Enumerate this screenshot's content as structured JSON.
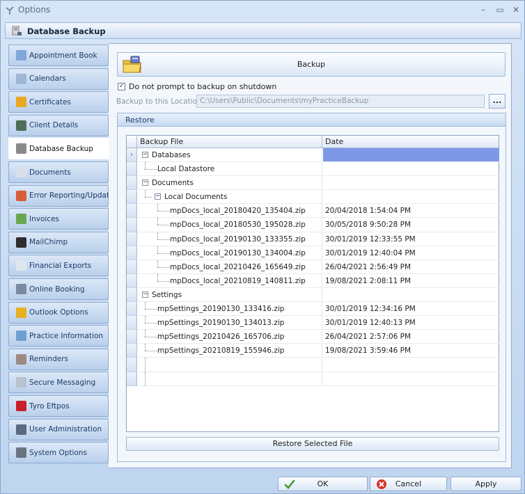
{
  "window": {
    "title": "Options",
    "controls": [
      "–",
      "▭",
      "✕"
    ]
  },
  "header": {
    "title": "Database Backup"
  },
  "sidebar": {
    "items": [
      {
        "label": "Appointment Book",
        "icon": "appointment-book-icon",
        "color": "#7fa7d8"
      },
      {
        "label": "Calendars",
        "icon": "calendar-icon",
        "color": "#9fb6d6"
      },
      {
        "label": "Certificates",
        "icon": "certificate-icon",
        "color": "#e8a820"
      },
      {
        "label": "Client Details",
        "icon": "client-details-icon",
        "color": "#4f6e58"
      },
      {
        "label": "Database Backup",
        "icon": "database-backup-icon",
        "color": "#8a8a8a",
        "active": true
      },
      {
        "label": "Documents",
        "icon": "documents-icon",
        "color": "#d9dfe8"
      },
      {
        "label": "Error Reporting/Updates",
        "icon": "error-reporting-icon",
        "color": "#d85c3a"
      },
      {
        "label": "Invoices",
        "icon": "invoices-icon",
        "color": "#6aa84f"
      },
      {
        "label": "MailChimp",
        "icon": "mailchimp-icon",
        "color": "#2e2e2e"
      },
      {
        "label": "Financial Exports",
        "icon": "financial-exports-icon",
        "color": "#dfe5ee"
      },
      {
        "label": "Online Booking",
        "icon": "online-booking-icon",
        "color": "#7a8aa0"
      },
      {
        "label": "Outlook Options",
        "icon": "outlook-icon",
        "color": "#e8b020"
      },
      {
        "label": "Practice Information",
        "icon": "practice-info-icon",
        "color": "#6f9fd0"
      },
      {
        "label": "Reminders",
        "icon": "reminders-icon",
        "color": "#9a8a80"
      },
      {
        "label": "Secure Messaging",
        "icon": "secure-messaging-icon",
        "color": "#b8c2d0"
      },
      {
        "label": "Tyro Eftpos",
        "icon": "tyro-eftpos-icon",
        "color": "#c8202a"
      },
      {
        "label": "User Administration",
        "icon": "user-admin-icon",
        "color": "#5a6a80"
      },
      {
        "label": "System Options",
        "icon": "system-options-icon",
        "color": "#6a7480"
      }
    ]
  },
  "backup": {
    "button_label": "Backup",
    "no_prompt_label": "Do not prompt to backup on shutdown",
    "no_prompt_checked": true,
    "location_label": "Backup to this Location:",
    "location_value": "C:\\Users\\Public\\Documents\\myPracticeBackup",
    "browse_label": "..."
  },
  "restore": {
    "title": "Restore",
    "columns": [
      "Backup File",
      "Date"
    ],
    "rows": [
      {
        "name": "Databases",
        "date": "",
        "level": 0,
        "expandable": true,
        "selected": true
      },
      {
        "name": "Local Datastore",
        "date": "",
        "level": 1,
        "expandable": false
      },
      {
        "name": "Documents",
        "date": "",
        "level": 0,
        "expandable": true
      },
      {
        "name": "Local Documents",
        "date": "",
        "level": 1,
        "expandable": true
      },
      {
        "name": "mpDocs_local_20180420_135404.zip",
        "date": "20/04/2018 1:54:04 PM",
        "level": 2,
        "expandable": false
      },
      {
        "name": "mpDocs_local_20180530_195028.zip",
        "date": "30/05/2018 9:50:28 PM",
        "level": 2,
        "expandable": false
      },
      {
        "name": "mpDocs_local_20190130_133355.zip",
        "date": "30/01/2019 12:33:55 PM",
        "level": 2,
        "expandable": false
      },
      {
        "name": "mpDocs_local_20190130_134004.zip",
        "date": "30/01/2019 12:40:04 PM",
        "level": 2,
        "expandable": false
      },
      {
        "name": "mpDocs_local_20210426_165649.zip",
        "date": "26/04/2021 2:56:49 PM",
        "level": 2,
        "expandable": false
      },
      {
        "name": "mpDocs_local_20210819_140811.zip",
        "date": "19/08/2021 2:08:11 PM",
        "level": 2,
        "expandable": false
      },
      {
        "name": "Settings",
        "date": "",
        "level": 0,
        "expandable": true
      },
      {
        "name": "mpSettings_20190130_133416.zip",
        "date": "30/01/2019 12:34:16 PM",
        "level": 1,
        "expandable": false
      },
      {
        "name": "mpSettings_20190130_134013.zip",
        "date": "30/01/2019 12:40:13 PM",
        "level": 1,
        "expandable": false
      },
      {
        "name": "mpSettings_20210426_165706.zip",
        "date": "26/04/2021 2:57:06 PM",
        "level": 1,
        "expandable": false
      },
      {
        "name": "mpSettings_20210819_155946.zip",
        "date": "19/08/2021 3:59:46 PM",
        "level": 1,
        "expandable": false
      },
      {
        "name": "",
        "date": "",
        "level": 0,
        "expandable": false
      },
      {
        "name": "",
        "date": "",
        "level": 0,
        "expandable": false
      }
    ],
    "restore_button_label": "Restore Selected File"
  },
  "footer": {
    "ok_label": "OK",
    "cancel_label": "Cancel",
    "apply_label": "Apply"
  },
  "colors": {
    "selection": "#7d98e6",
    "accent": "#1d3a66"
  }
}
